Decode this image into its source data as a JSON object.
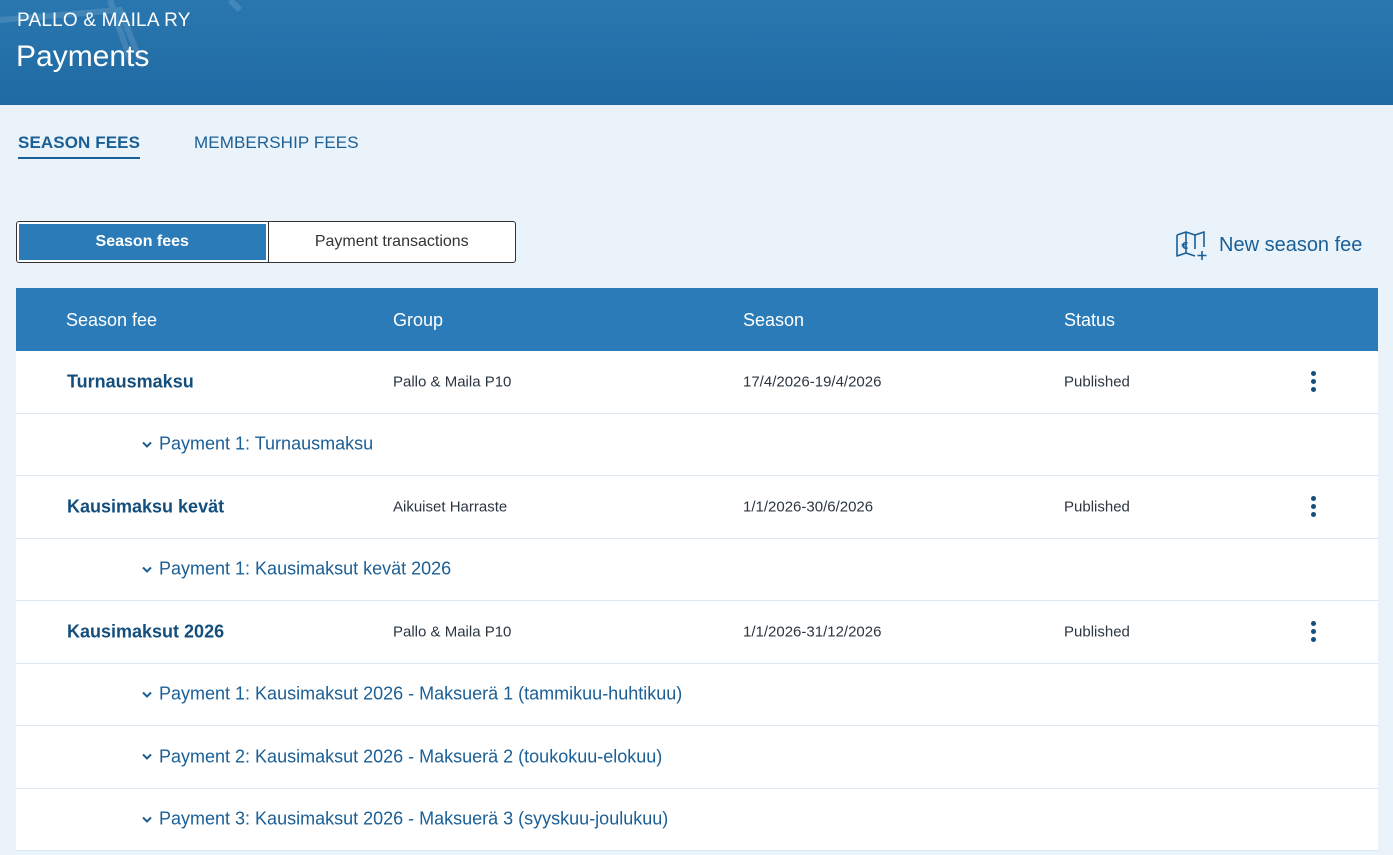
{
  "header": {
    "org": "PALLO & MAILA RY",
    "title": "Payments"
  },
  "tabs": [
    {
      "label": "SEASON FEES",
      "active": true
    },
    {
      "label": "MEMBERSHIP FEES",
      "active": false
    }
  ],
  "segmented": {
    "season_fees": "Season fees",
    "payment_transactions": "Payment transactions"
  },
  "actions": {
    "new_season_fee": "New season fee",
    "new_icon": "euro-map-plus-icon"
  },
  "table": {
    "columns": [
      "Season fee",
      "Group",
      "Season",
      "Status"
    ],
    "fees": [
      {
        "name": "Turnausmaksu",
        "group": "Pallo & Maila P10",
        "season": "17/4/2026-19/4/2026",
        "status": "Published",
        "payments": [
          "Payment 1: Turnausmaksu"
        ]
      },
      {
        "name": "Kausimaksu kevät",
        "group": "Aikuiset Harraste",
        "season": "1/1/2026-30/6/2026",
        "status": "Published",
        "payments": [
          "Payment 1: Kausimaksut kevät 2026"
        ]
      },
      {
        "name": "Kausimaksut 2026",
        "group": "Pallo & Maila P10",
        "season": "1/1/2026-31/12/2026",
        "status": "Published",
        "payments": [
          "Payment 1: Kausimaksut 2026 - Maksuerä 1 (tammikuu-huhtikuu)",
          "Payment 2: Kausimaksut 2026 - Maksuerä 2 (toukokuu-elokuu)",
          "Payment 3: Kausimaksut 2026 - Maksuerä 3 (syyskuu-joulukuu)"
        ]
      }
    ]
  },
  "colors": {
    "header_bg": "#1f6aa3",
    "accent": "#2a7bb7",
    "link": "#1a5f96",
    "page_bg": "#eaf3fa"
  }
}
